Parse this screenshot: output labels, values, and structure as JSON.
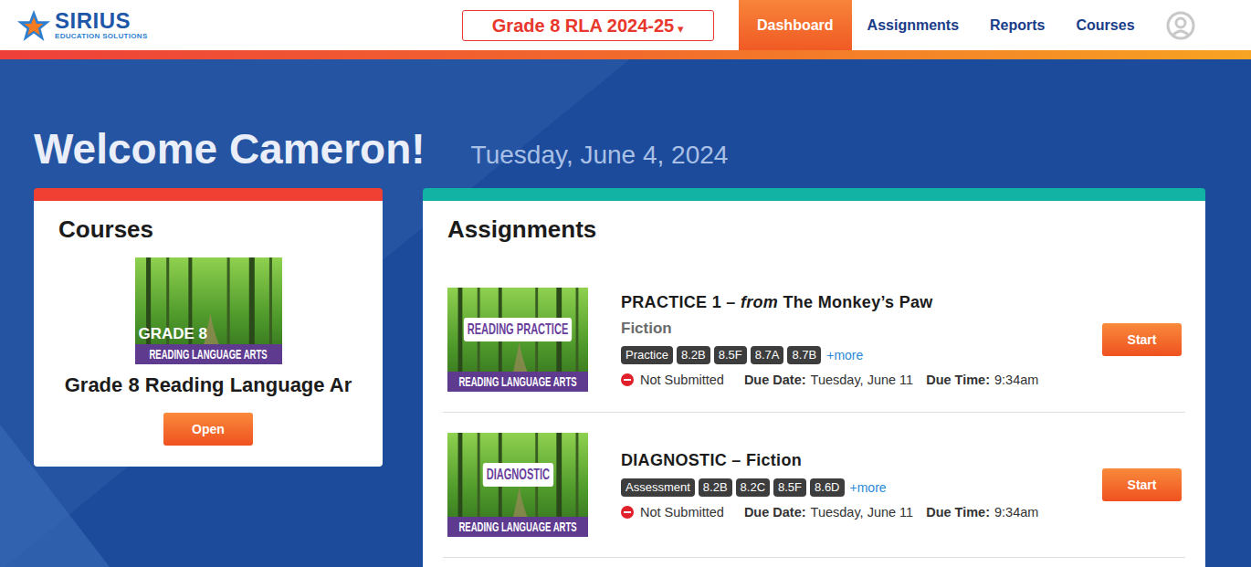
{
  "header": {
    "logo": {
      "name": "SIRIUS",
      "tagline": "EDUCATION SOLUTIONS"
    },
    "class_select": {
      "value": "Grade 8 RLA 2024-25",
      "arrow": "▾"
    },
    "nav": [
      {
        "label": "Dashboard",
        "selected": true
      },
      {
        "label": "Assignments",
        "selected": false
      },
      {
        "label": "Reports",
        "selected": false
      },
      {
        "label": "Courses",
        "selected": false
      }
    ]
  },
  "welcome": {
    "greeting": "Welcome Cameron!",
    "date": "Tuesday, June 4, 2024"
  },
  "courses": {
    "title": "Courses",
    "items": [
      {
        "thumbnail": {
          "label": "GRADE 8",
          "banner": "READING LANGUAGE ARTS"
        },
        "name": "Grade 8 Reading Language Ar",
        "button": "Open"
      }
    ]
  },
  "assignments": {
    "title": "Assignments",
    "items": [
      {
        "thumbnail": {
          "label": "READING PRACTICE",
          "banner": "READING LANGUAGE ARTS"
        },
        "title": [
          {
            "text": "PRACTICE 1 – ",
            "italic": false
          },
          {
            "text": "from",
            "italic": true
          },
          {
            "text": " The Monkey’s Paw",
            "italic": false
          }
        ],
        "genre": "Fiction",
        "tags": [
          "Practice",
          "8.2B",
          "8.5F",
          "8.7A",
          "8.7B"
        ],
        "more": "+more",
        "status": "Not Submitted",
        "due_date_label": "Due Date:",
        "due_date": "Tuesday, June 11",
        "due_time_label": "Due Time:",
        "due_time": "9:34am",
        "button": "Start"
      },
      {
        "thumbnail": {
          "label": "DIAGNOSTIC",
          "banner": "READING LANGUAGE ARTS"
        },
        "title": [
          {
            "text": "DIAGNOSTIC – Fiction",
            "italic": false
          }
        ],
        "tags": [
          "Assessment",
          "8.2B",
          "8.2C",
          "8.5F",
          "8.6D"
        ],
        "more": "+more",
        "status": "Not Submitted",
        "due_date_label": "Due Date:",
        "due_date": "Tuesday, June 11",
        "due_time_label": "Due Time:",
        "due_time": "9:34am",
        "button": "Start"
      }
    ]
  }
}
